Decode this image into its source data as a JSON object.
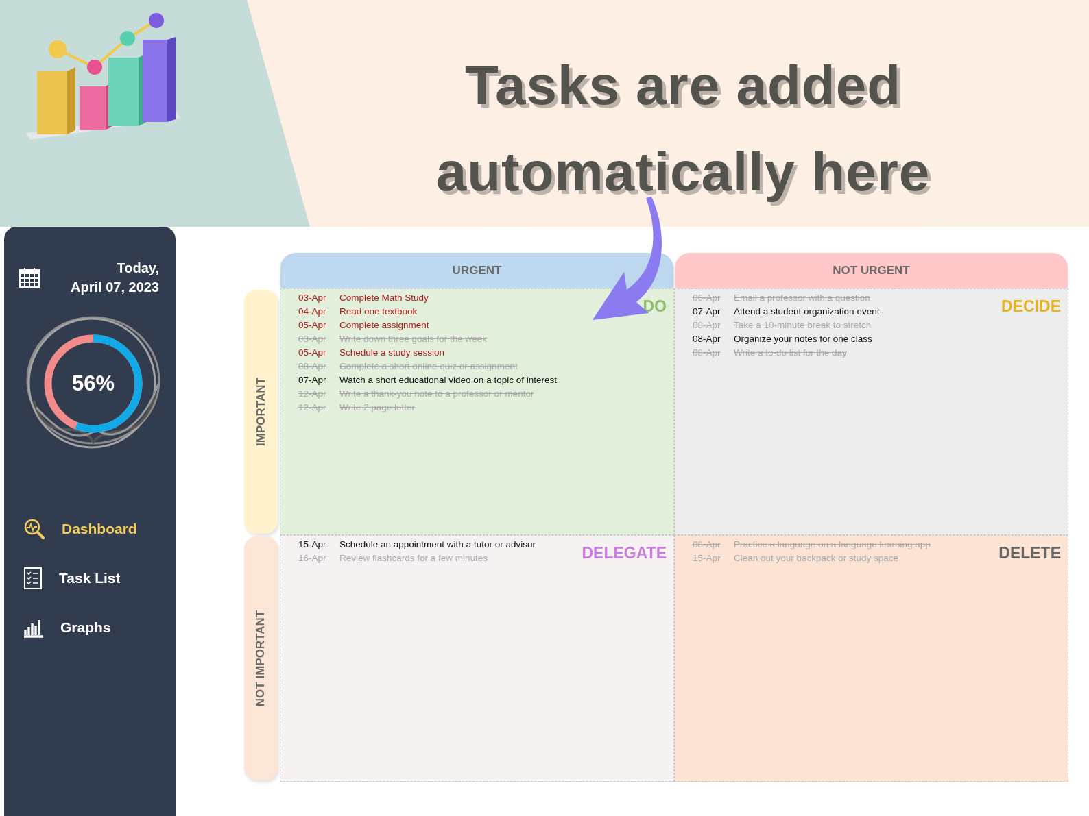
{
  "headline": [
    "Tasks are added",
    "automatically here"
  ],
  "sidebar": {
    "date_lines": [
      "Today,",
      "April 07, 2023"
    ],
    "progress": {
      "level": 0.56,
      "reading": "56%"
    },
    "nav": [
      {
        "label": "Dashboard",
        "selected": true
      },
      {
        "label": "Task List",
        "selected": false
      },
      {
        "label": "Graphs",
        "selected": false
      }
    ]
  },
  "columns": [
    {
      "label": "URGENT",
      "color": "#bdd7ee"
    },
    {
      "label": "NOT URGENT",
      "color": "#ffc7c7"
    }
  ],
  "rows": [
    {
      "label": "IMPORTANT",
      "color": "#fff2cc"
    },
    {
      "label": "NOT IMPORTANT",
      "color": "#fbe5d6"
    }
  ],
  "quadrants": [
    {
      "label": "DO",
      "color": "#8fbf6a",
      "tasks": [
        {
          "date": "03-Apr",
          "text": "Complete Math Study",
          "done": false,
          "overdue": true
        },
        {
          "date": "04-Apr",
          "text": "Read one textbook",
          "done": false,
          "overdue": true
        },
        {
          "date": "05-Apr",
          "text": "Complete assignment",
          "done": false,
          "overdue": true
        },
        {
          "date": "03-Apr",
          "text": "Write down three goals for the week",
          "done": true
        },
        {
          "date": "05-Apr",
          "text": "Schedule a study session",
          "done": false,
          "overdue": true
        },
        {
          "date": "08-Apr",
          "text": "Complete a short online quiz or assignment",
          "done": true
        },
        {
          "date": "07-Apr",
          "text": "Watch a short educational video on a topic of interest",
          "done": false,
          "overdue": false
        },
        {
          "date": "12-Apr",
          "text": "Write a thank-you note to a professor or mentor",
          "done": true
        },
        {
          "date": "12-Apr",
          "text": "Write 2 page letter",
          "done": true
        }
      ]
    },
    {
      "label": "DECIDE",
      "color": "#e6b422",
      "tasks": [
        {
          "date": "06-Apr",
          "text": "Email a professor with a question",
          "done": true
        },
        {
          "date": "07-Apr",
          "text": "Attend a student organization event",
          "done": false,
          "overdue": false
        },
        {
          "date": "08-Apr",
          "text": "Take a 10-minute break to stretch",
          "done": true
        },
        {
          "date": "08-Apr",
          "text": "Organize your notes for one class",
          "done": false,
          "overdue": false
        },
        {
          "date": "08-Apr",
          "text": "Write a to-do list for the day",
          "done": true
        }
      ]
    },
    {
      "label": "DELEGATE",
      "color": "#cc7de0",
      "tasks": [
        {
          "date": "15-Apr",
          "text": "Schedule an appointment with a tutor or advisor",
          "done": false,
          "overdue": false
        },
        {
          "date": "16-Apr",
          "text": "Review flashcards for a few minutes",
          "done": true
        }
      ]
    },
    {
      "label": "DELETE",
      "color": "#666666",
      "tasks": [
        {
          "date": "08-Apr",
          "text": "Practice a language on a language learning app",
          "done": true
        },
        {
          "date": "15-Apr",
          "text": "Clean out your backpack or study space",
          "done": true
        }
      ]
    }
  ]
}
